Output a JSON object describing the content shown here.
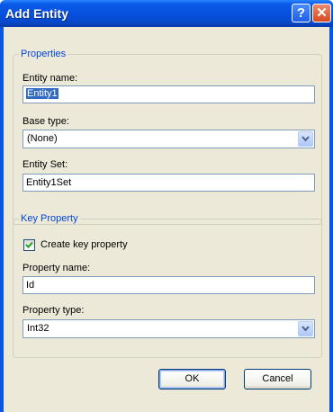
{
  "window": {
    "title": "Add Entity"
  },
  "titlebar_buttons": {
    "help_label": "?",
    "close_label": "✕"
  },
  "properties": {
    "legend": "Properties",
    "entity_name_label": "Entity name:",
    "entity_name_value": "Entity1",
    "base_type_label": "Base type:",
    "base_type_value": "(None)",
    "entity_set_label": "Entity Set:",
    "entity_set_value": "Entity1Set"
  },
  "key_property": {
    "legend": "Key Property",
    "create_key_label": "Create key property",
    "create_key_checked": true,
    "property_name_label": "Property name:",
    "property_name_value": "Id",
    "property_type_label": "Property type:",
    "property_type_value": "Int32"
  },
  "buttons": {
    "ok_label": "OK",
    "cancel_label": "Cancel"
  },
  "colors": {
    "titlebar": "#0650dd",
    "client": "#ece9d8",
    "legend_text": "#0046d5",
    "selection": "#316ac5"
  }
}
